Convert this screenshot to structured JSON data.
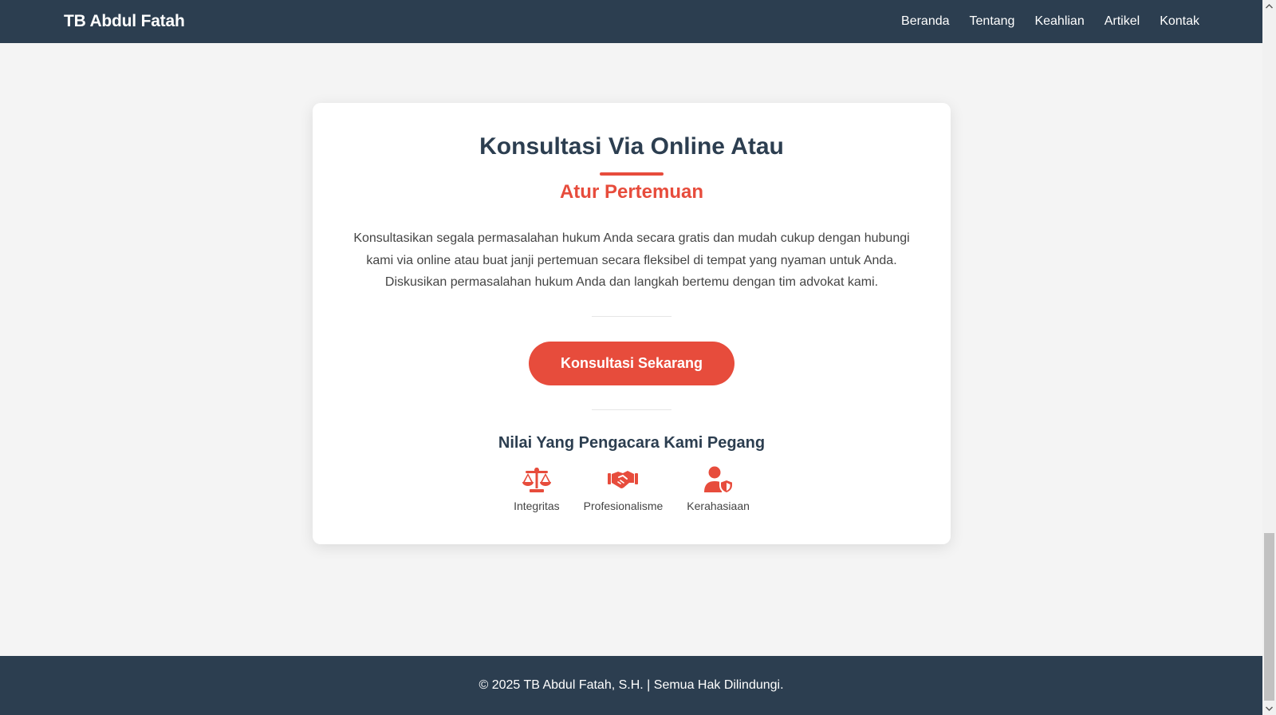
{
  "navbar": {
    "brand": "TB Abdul Fatah",
    "links": [
      "Beranda",
      "Tentang",
      "Keahlian",
      "Artikel",
      "Kontak"
    ]
  },
  "card": {
    "title": "Konsultasi Via Online Atau",
    "subtitle": "Atur Pertemuan",
    "description": "Konsultasikan segala permasalahan hukum Anda secara gratis dan mudah cukup dengan hubungi kami via online atau buat janji pertemuan secara fleksibel di tempat yang nyaman untuk Anda. Diskusikan permasalahan hukum Anda dan langkah bertemu dengan tim advokat kami.",
    "cta_label": "Konsultasi Sekarang",
    "values_title": "Nilai Yang Pengacara Kami Pegang",
    "values": [
      {
        "icon": "scale-balance-icon",
        "label": "Integritas"
      },
      {
        "icon": "handshake-icon",
        "label": "Profesionalisme"
      },
      {
        "icon": "user-shield-icon",
        "label": "Kerahasiaan"
      }
    ]
  },
  "footer": {
    "text": "© 2025 TB Abdul Fatah, S.H. | Semua Hak Dilindungi."
  },
  "colors": {
    "navy": "#2c3e50",
    "accent": "#e74c3c",
    "background": "#f4f4f4"
  }
}
